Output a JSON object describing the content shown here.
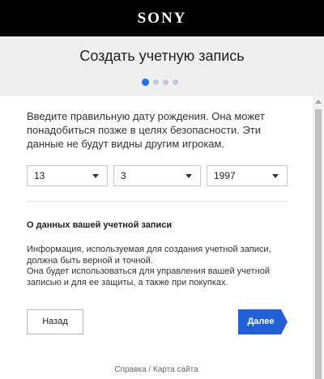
{
  "brand": {
    "logo_text": "SONY",
    "bar_color": "#000000"
  },
  "header": {
    "title": "Создать учетную запись",
    "steps_total": 4,
    "step_current": 1,
    "active_dot_color": "#1a73e8",
    "inactive_dot_color": "#c3cad6"
  },
  "form": {
    "intro": "Введите правильную дату рождения. Она может понадобиться позже в целях безопасности. Эти данные не будут видны другим игрокам.",
    "birthdate": {
      "day": "13",
      "month": "3",
      "year": "1997"
    },
    "info_heading": "О данных вашей учетной записи",
    "info_line1": "Информация, используемая для создания учетной записи, должна быть верной и точной.",
    "info_line2": "Она будет использоваться для управления вашей учетной записью и для ее защиты, а также при покупках."
  },
  "buttons": {
    "back_label": "Назад",
    "next_label": "Далее",
    "next_color": "#2260d8"
  },
  "footer": {
    "help_label": "Справка",
    "separator": "/",
    "sitemap_label": "Карта сайта"
  }
}
